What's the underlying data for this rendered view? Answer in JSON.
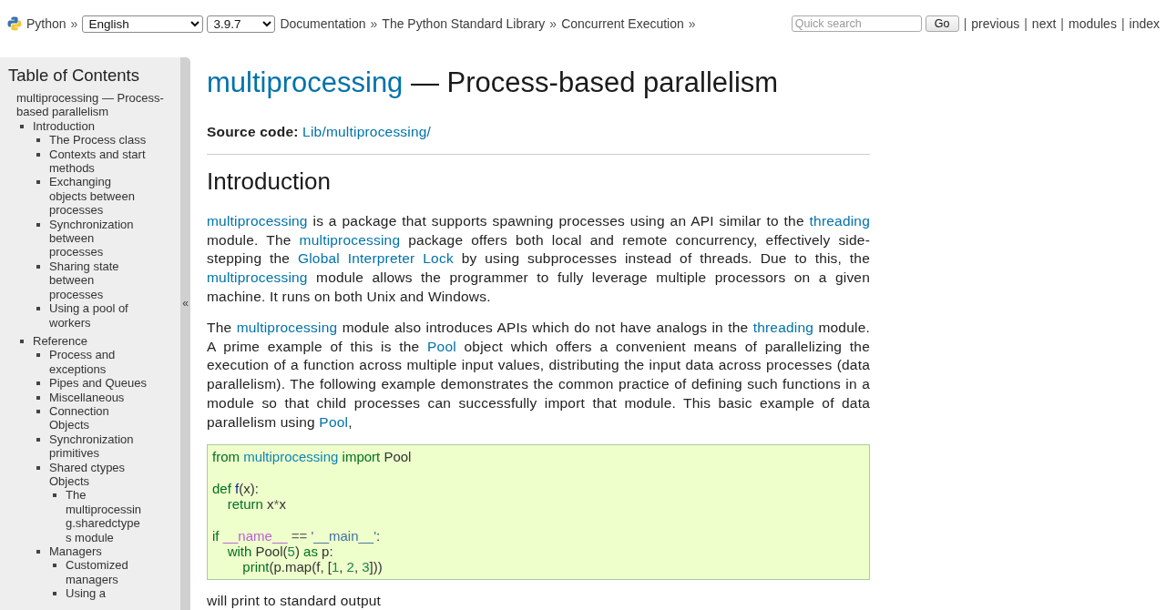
{
  "topbar": {
    "home": {
      "label": "Python",
      "separator": "»"
    },
    "language": "English",
    "version": "3.9.7",
    "breadcrumbs": [
      {
        "label": "Documentation",
        "separator": "»"
      },
      {
        "label": "The Python Standard Library",
        "separator": "»"
      },
      {
        "label": "Concurrent Execution",
        "separator": "»"
      }
    ],
    "search": {
      "placeholder": "Quick search",
      "button": "Go"
    },
    "nav": [
      {
        "separator": "|",
        "label": "previous"
      },
      {
        "separator": "|",
        "label": "next"
      },
      {
        "separator": "|",
        "label": "modules"
      },
      {
        "separator": "|",
        "label": "index"
      }
    ]
  },
  "sidebar": {
    "title": "Table of Contents",
    "collapse_label": "«",
    "items": [
      {
        "label": "multiprocessing — Process-based parallelism",
        "children": [
          {
            "label": "Introduction",
            "children": [
              {
                "label": "The Process class"
              },
              {
                "label": "Contexts and start methods"
              },
              {
                "label": "Exchanging objects between processes"
              },
              {
                "label": "Synchronization between processes"
              },
              {
                "label": "Sharing state between processes"
              },
              {
                "label": "Using a pool of workers"
              }
            ]
          },
          {
            "label": "Reference",
            "children": [
              {
                "label": "Process and exceptions"
              },
              {
                "label": "Pipes and Queues"
              },
              {
                "label": "Miscellaneous"
              },
              {
                "label": "Connection Objects"
              },
              {
                "label": "Synchronization primitives"
              },
              {
                "label": "Shared ctypes Objects",
                "children": [
                  {
                    "label": "The multiprocessing.sharedctypes module"
                  }
                ]
              },
              {
                "label": "Managers",
                "children": [
                  {
                    "label": "Customized managers"
                  },
                  {
                    "label": "Using a"
                  }
                ]
              }
            ]
          }
        ]
      }
    ]
  },
  "title": [
    {
      "kind": "link",
      "text": "multiprocessing"
    },
    {
      "kind": "text",
      "text": " — Process-based parallelism"
    }
  ],
  "source": {
    "label": "Source code:",
    "link": "Lib/multiprocessing/"
  },
  "section": {
    "heading": "Introduction",
    "blocks": [
      {
        "kind": "paragraph",
        "segments": [
          {
            "kind": "link",
            "text": "multiprocessing"
          },
          {
            "kind": "text",
            "text": " is a package that supports spawning processes using an API similar to the "
          },
          {
            "kind": "link",
            "text": "threading"
          },
          {
            "kind": "text",
            "text": " module. The "
          },
          {
            "kind": "link",
            "text": "multiprocessing"
          },
          {
            "kind": "text",
            "text": " package offers both local and remote concurrency, effectively side-stepping the "
          },
          {
            "kind": "link",
            "text": "Global Interpreter Lock"
          },
          {
            "kind": "text",
            "text": " by using subprocesses instead of threads. Due to this, the "
          },
          {
            "kind": "link",
            "text": "multiprocessing"
          },
          {
            "kind": "text",
            "text": " module allows the programmer to fully leverage multiple processors on a given machine. It runs on both Unix and Windows."
          }
        ]
      },
      {
        "kind": "paragraph",
        "segments": [
          {
            "kind": "text",
            "text": "The "
          },
          {
            "kind": "link",
            "text": "multiprocessing"
          },
          {
            "kind": "text",
            "text": " module also introduces APIs which do not have analogs in the "
          },
          {
            "kind": "link",
            "text": "threading"
          },
          {
            "kind": "text",
            "text": " module. A prime example of this is the "
          },
          {
            "kind": "link",
            "text": "Pool"
          },
          {
            "kind": "text",
            "text": " object which offers a convenient means of parallelizing the execution of a function across multiple input values, distributing the input data across processes (data parallelism). The following example demonstrates the common practice of defining such functions in a module so that child processes can successfully import that module. This basic example of data parallelism using "
          },
          {
            "kind": "link",
            "text": "Pool"
          },
          {
            "kind": "text",
            "text": ","
          }
        ]
      },
      {
        "kind": "code",
        "tokens": [
          {
            "kind": "keyword",
            "text": "from "
          },
          {
            "kind": "namespace",
            "text": "multiprocessing"
          },
          {
            "kind": "keyword",
            "text": " import"
          },
          {
            "kind": "plain",
            "text": " Pool\n\n"
          },
          {
            "kind": "keyword",
            "text": "def "
          },
          {
            "kind": "function",
            "text": "f"
          },
          {
            "kind": "plain",
            "text": "(x):\n    "
          },
          {
            "kind": "keyword",
            "text": "return"
          },
          {
            "kind": "plain",
            "text": " x"
          },
          {
            "kind": "operator",
            "text": "*"
          },
          {
            "kind": "plain",
            "text": "x\n\n"
          },
          {
            "kind": "keyword",
            "text": "if "
          },
          {
            "kind": "variable",
            "text": "__name__"
          },
          {
            "kind": "operator",
            "text": " == "
          },
          {
            "kind": "string",
            "text": "'__main__'"
          },
          {
            "kind": "plain",
            "text": ":\n    "
          },
          {
            "kind": "keyword",
            "text": "with"
          },
          {
            "kind": "plain",
            "text": " Pool("
          },
          {
            "kind": "number",
            "text": "5"
          },
          {
            "kind": "plain",
            "text": ") "
          },
          {
            "kind": "keyword",
            "text": "as"
          },
          {
            "kind": "plain",
            "text": " p:\n        "
          },
          {
            "kind": "builtin",
            "text": "print"
          },
          {
            "kind": "plain",
            "text": "(p.map(f, ["
          },
          {
            "kind": "number",
            "text": "1"
          },
          {
            "kind": "plain",
            "text": ", "
          },
          {
            "kind": "number",
            "text": "2"
          },
          {
            "kind": "plain",
            "text": ", "
          },
          {
            "kind": "number",
            "text": "3"
          },
          {
            "kind": "plain",
            "text": "]))"
          }
        ]
      },
      {
        "kind": "paragraph",
        "segments": [
          {
            "kind": "text",
            "text": "will print to standard output"
          }
        ]
      }
    ]
  }
}
